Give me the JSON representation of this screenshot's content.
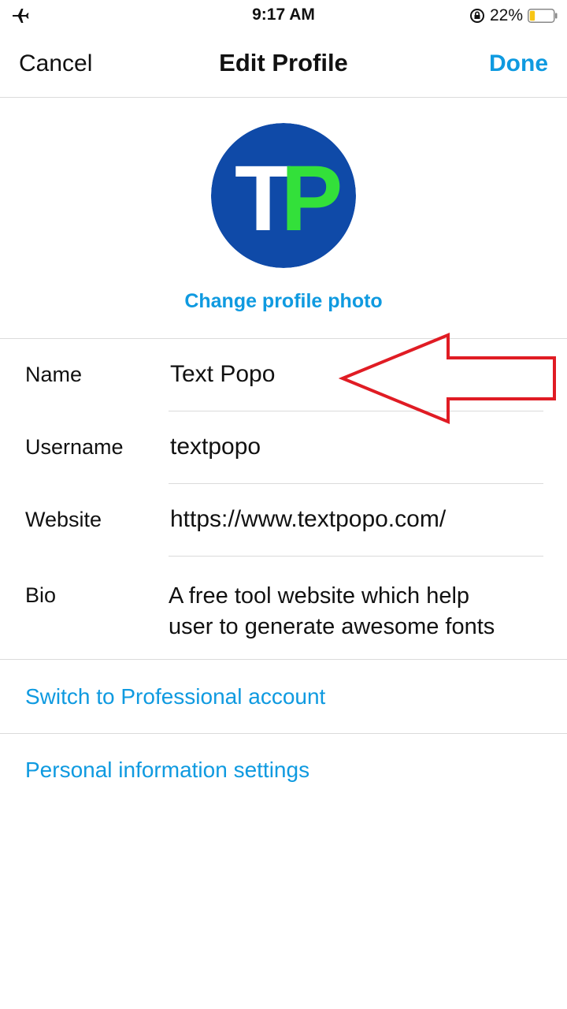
{
  "status_bar": {
    "time": "9:17 AM",
    "battery_percent": "22%",
    "battery_level": 0.22,
    "icons": {
      "left": "airplane-mode-icon",
      "lock": "orientation-lock-icon",
      "battery": "battery-icon"
    }
  },
  "nav": {
    "cancel_label": "Cancel",
    "title": "Edit Profile",
    "done_label": "Done"
  },
  "profile": {
    "avatar_initial_1": "T",
    "avatar_initial_2": "P",
    "change_photo_label": "Change profile photo"
  },
  "form": {
    "fields": [
      {
        "label": "Name",
        "value": "Text Popo"
      },
      {
        "label": "Username",
        "value": "textpopo"
      },
      {
        "label": "Website",
        "value": "https://www.textpopo.com/"
      },
      {
        "label": "Bio",
        "value_line_1": "A free tool website which help",
        "value_line_2": "user to generate awesome fonts"
      }
    ]
  },
  "links": {
    "professional": "Switch to Professional account",
    "personal_info": "Personal information settings"
  },
  "colors": {
    "accent_blue": "#0f9ae0",
    "avatar_blue": "#0f4aa8",
    "avatar_green": "#33e03a",
    "annotation_red": "#e01c24",
    "divider": "#dbdbdb"
  }
}
